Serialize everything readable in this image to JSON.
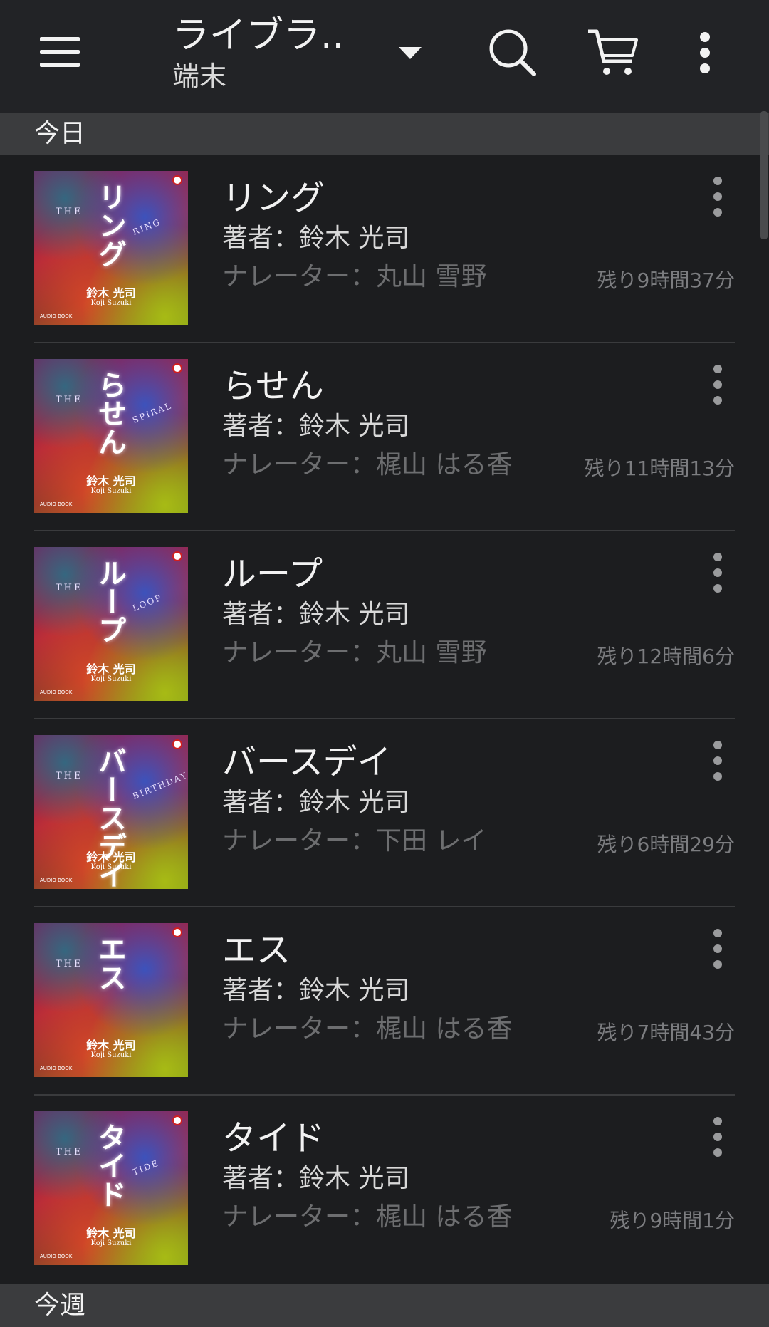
{
  "app_bar": {
    "title": "ライブラ..",
    "subtitle": "端末",
    "icons": [
      "menu-icon",
      "dropdown-arrow-icon",
      "search-icon",
      "cart-icon",
      "more-vert-icon"
    ]
  },
  "sections": [
    {
      "label": "今日"
    },
    {
      "label": "今週"
    }
  ],
  "books": [
    {
      "title": "リング",
      "author": "著者：鈴木 光司",
      "narrator": "ナレーター：丸山 雪野",
      "remaining": "残り9時間37分",
      "cover": {
        "title": "リング",
        "english": "RING"
      }
    },
    {
      "title": "らせん",
      "author": "著者：鈴木 光司",
      "narrator": "ナレーター：梶山 はる香",
      "remaining": "残り11時間13分",
      "cover": {
        "title": "らせん",
        "english": "SPIRAL"
      }
    },
    {
      "title": "ループ",
      "author": "著者：鈴木 光司",
      "narrator": "ナレーター：丸山 雪野",
      "remaining": "残り12時間6分",
      "cover": {
        "title": "ループ",
        "english": "LOOP"
      }
    },
    {
      "title": "バースデイ",
      "author": "著者：鈴木 光司",
      "narrator": "ナレーター：下田 レイ",
      "remaining": "残り6時間29分",
      "cover": {
        "title": "バースデイ",
        "english": "BIRTHDAY"
      }
    },
    {
      "title": "エス",
      "author": "著者：鈴木 光司",
      "narrator": "ナレーター：梶山 はる香",
      "remaining": "残り7時間43分",
      "cover": {
        "title": "エス",
        "english": ""
      }
    },
    {
      "title": "タイド",
      "author": "著者：鈴木 光司",
      "narrator": "ナレーター：梶山 はる香",
      "remaining": "残り9時間1分",
      "cover": {
        "title": "タイド",
        "english": "TIDE"
      }
    }
  ],
  "cover_common": {
    "the": "THE",
    "author_jp": "鈴木 光司",
    "author_en": "Koji Suzuki",
    "series": "AUDIO BOOK"
  },
  "colors": {
    "background": "#1c1d1f",
    "app_bar": "#222326",
    "section_header": "#3b3c3e",
    "primary_text": "#f2f2f2",
    "secondary_text": "#6d6e70"
  }
}
